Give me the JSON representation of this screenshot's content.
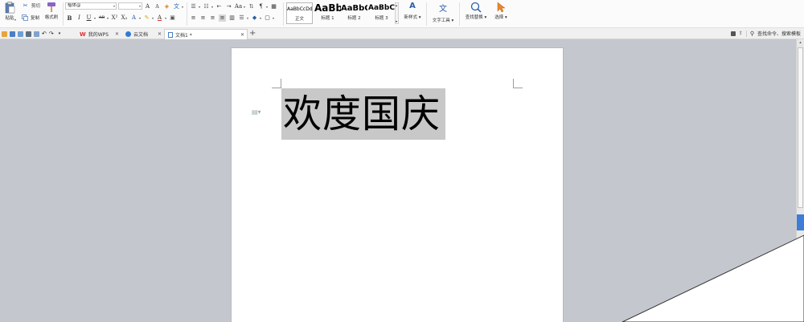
{
  "ribbon": {
    "paste_label": "粘贴",
    "cut_label": "剪切",
    "copy_label": "复制",
    "format_painter_label": "格式刷",
    "font_name": "楷体@",
    "font_size": "",
    "styles": [
      {
        "preview": "AaBbCcDd",
        "name": "正文"
      },
      {
        "preview": "AaBb",
        "name": "标题 1"
      },
      {
        "preview": "AaBbC",
        "name": "标题 2"
      },
      {
        "preview": "AaBbC",
        "name": "标题 3"
      }
    ],
    "new_style_label": "新样式",
    "text_tools_label": "文字工具",
    "find_replace_label": "查找替换",
    "select_label": "选择"
  },
  "tabs": [
    {
      "label": "我的WPS"
    },
    {
      "label": "云文档"
    },
    {
      "label": "文档1 *"
    }
  ],
  "search": {
    "placeholder": "查找命令、搜索模板"
  },
  "document": {
    "heading": "欢度国庆"
  },
  "colors": {
    "workspace": "#c4c7ce",
    "wps_red": "#d9302b",
    "cloud_blue": "#2f7bd6",
    "selection": "#c8c8c8",
    "scroll_blue": "#3d7dd8"
  }
}
